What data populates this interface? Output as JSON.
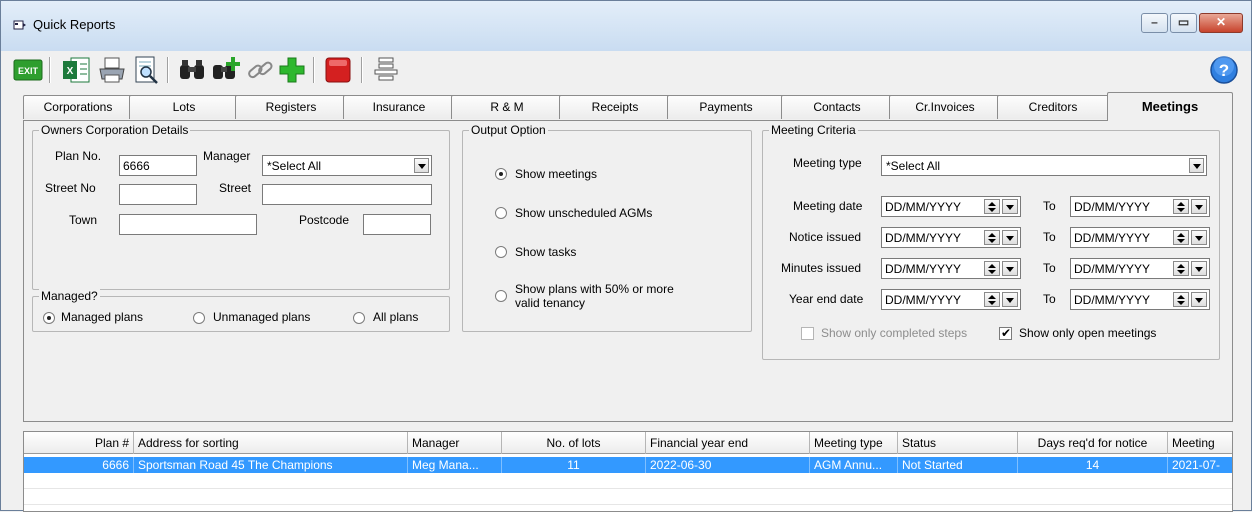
{
  "window": {
    "title": "Quick Reports"
  },
  "toolbar": {
    "exit_label": "EXIT",
    "buttons": [
      "exit-icon",
      "excel-icon",
      "print-icon",
      "print-preview-icon",
      "find-icon",
      "find-next-icon",
      "link-icon",
      "add-icon",
      "stop-icon",
      "align-icon"
    ]
  },
  "tabs": [
    {
      "label": "Corporations"
    },
    {
      "label": "Lots"
    },
    {
      "label": "Registers"
    },
    {
      "label": "Insurance"
    },
    {
      "label": "R & M"
    },
    {
      "label": "Receipts"
    },
    {
      "label": "Payments"
    },
    {
      "label": "Contacts"
    },
    {
      "label": "Cr.Invoices"
    },
    {
      "label": "Creditors"
    },
    {
      "label": "Meetings"
    }
  ],
  "owners": {
    "title": "Owners Corporation Details",
    "plan_no_label": "Plan No.",
    "plan_no_value": "6666",
    "manager_label": "Manager",
    "manager_value": "*Select All",
    "street_no_label": "Street No",
    "street_no_value": "",
    "street_label": "Street",
    "street_value": "",
    "town_label": "Town",
    "town_value": "",
    "postcode_label": "Postcode",
    "postcode_value": ""
  },
  "managed": {
    "title": "Managed?",
    "options": [
      {
        "label": "Managed plans",
        "selected": true
      },
      {
        "label": "Unmanaged plans",
        "selected": false
      },
      {
        "label": "All plans",
        "selected": false
      }
    ]
  },
  "output": {
    "title": "Output Option",
    "options": [
      {
        "label": "Show meetings",
        "selected": true
      },
      {
        "label": "Show unscheduled AGMs",
        "selected": false
      },
      {
        "label": "Show tasks",
        "selected": false
      },
      {
        "label": "Show plans with 50% or more",
        "label2": "valid tenancy",
        "selected": false
      }
    ]
  },
  "criteria": {
    "title": "Meeting Criteria",
    "meeting_type_label": "Meeting type",
    "meeting_type_value": "*Select All",
    "to_label": "To",
    "rows": [
      {
        "label": "Meeting date",
        "from": "DD/MM/YYYY",
        "to": "DD/MM/YYYY"
      },
      {
        "label": "Notice issued",
        "from": "DD/MM/YYYY",
        "to": "DD/MM/YYYY"
      },
      {
        "label": "Minutes issued",
        "from": "DD/MM/YYYY",
        "to": "DD/MM/YYYY"
      },
      {
        "label": "Year end date",
        "from": "DD/MM/YYYY",
        "to": "DD/MM/YYYY"
      }
    ],
    "completed_label": "Show only completed steps",
    "completed_checked": false,
    "open_label": "Show only open meetings",
    "open_checked": true
  },
  "grid": {
    "columns": [
      "Plan #",
      "Address for sorting",
      "Manager",
      "No. of lots",
      "Financial year end",
      "Meeting type",
      "Status",
      "Days req'd for notice",
      "Meeting"
    ],
    "rows": [
      [
        "6666",
        "Sportsman Road 45 The Champions",
        "Meg Mana...",
        "11",
        "2022-06-30",
        "AGM Annu...",
        "Not Started",
        "14",
        "2021-07-"
      ]
    ]
  },
  "colors": {
    "selection": "#3399ff",
    "exit_green": "#2e9e2e",
    "stop_red": "#d42020"
  }
}
